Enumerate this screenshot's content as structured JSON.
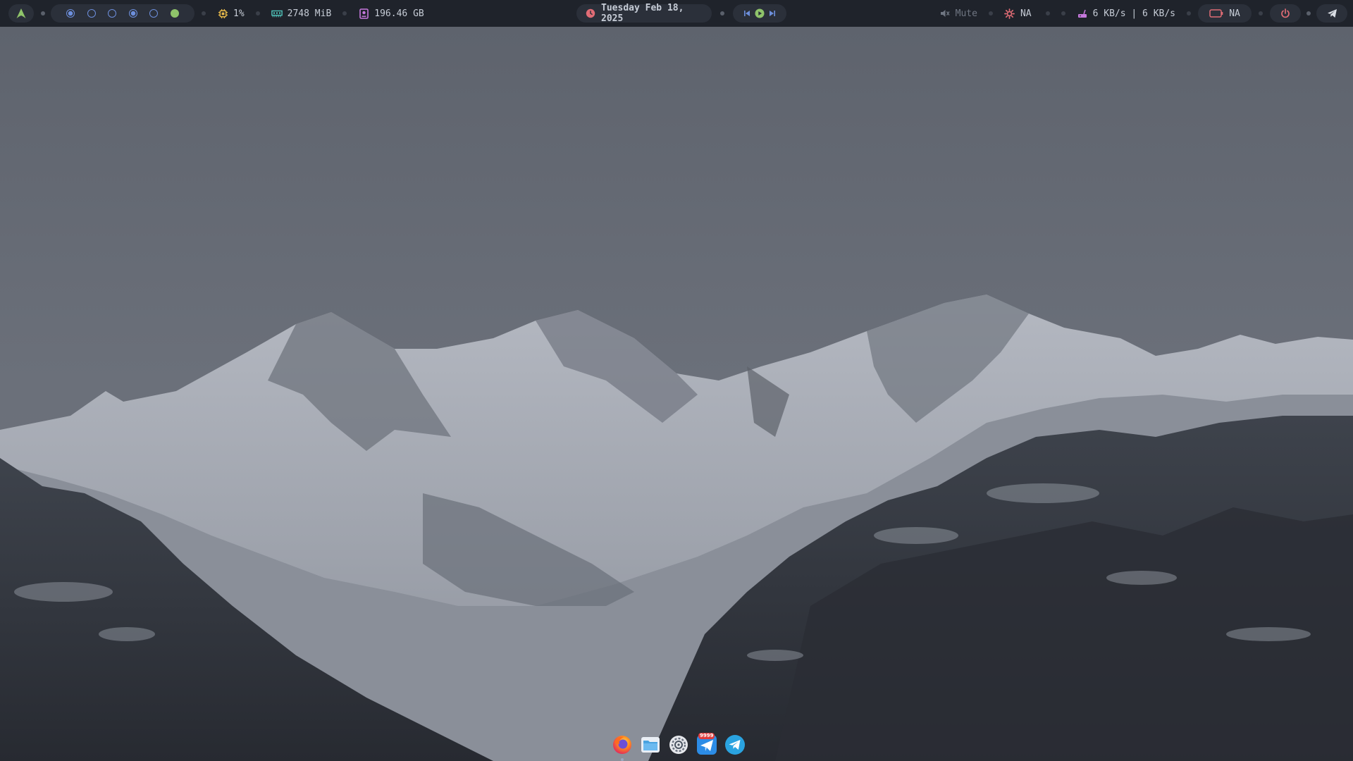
{
  "topbar": {
    "launcher": {
      "icon": "arch-logo-icon"
    },
    "workspaces": [
      {
        "icon": "workspace-circle-icon",
        "state": "occupied"
      },
      {
        "icon": "workspace-circle-icon",
        "state": "empty"
      },
      {
        "icon": "workspace-circle-icon",
        "state": "empty"
      },
      {
        "icon": "workspace-circle-icon",
        "state": "occupied"
      },
      {
        "icon": "workspace-circle-icon",
        "state": "empty"
      },
      {
        "icon": "workspace-circle-icon",
        "state": "active"
      }
    ],
    "cpu": {
      "icon": "cpu-chip-icon",
      "value": "1%"
    },
    "memory": {
      "icon": "ram-icon",
      "value": "2748 MiB"
    },
    "disk": {
      "icon": "disk-icon",
      "value": "196.46 GB"
    },
    "clock": {
      "icon": "clock-icon",
      "value": "Tuesday Feb 18, 2025"
    },
    "media": {
      "prev_icon": "skip-previous-icon",
      "play_icon": "play-icon",
      "next_icon": "skip-next-icon"
    },
    "volume": {
      "icon": "speaker-muted-icon",
      "value": "Mute"
    },
    "brightness": {
      "icon": "brightness-icon",
      "value": "NA"
    },
    "network": {
      "icon": "network-icon",
      "value": "6 KB/s | 6 KB/s"
    },
    "battery": {
      "icon": "battery-icon",
      "value": "NA"
    },
    "power": {
      "icon": "power-icon"
    },
    "telegram_tray": {
      "icon": "telegram-icon"
    }
  },
  "dock": {
    "items": [
      {
        "name": "Firefox",
        "icon": "firefox-icon",
        "active": true
      },
      {
        "name": "Files",
        "icon": "folder-icon",
        "active": false
      },
      {
        "name": "Settings",
        "icon": "settings-icon",
        "active": false
      },
      {
        "name": "Mail",
        "icon": "mail-icon",
        "active": false,
        "badge": "9999"
      },
      {
        "name": "Telegram",
        "icon": "telegram-icon",
        "active": false
      }
    ]
  },
  "colors": {
    "bar_bg": "#1f232b",
    "pill_bg": "#2b303a",
    "text": "#c6ccd6",
    "workspace": "#6d8fdc",
    "workspace_active": "#8fc46a",
    "cpu": "#e5b84a",
    "memory": "#4fc0b8",
    "disk": "#c678dd",
    "clock": "#e06c75",
    "media": "#6d8fdc",
    "power": "#e06c75"
  }
}
